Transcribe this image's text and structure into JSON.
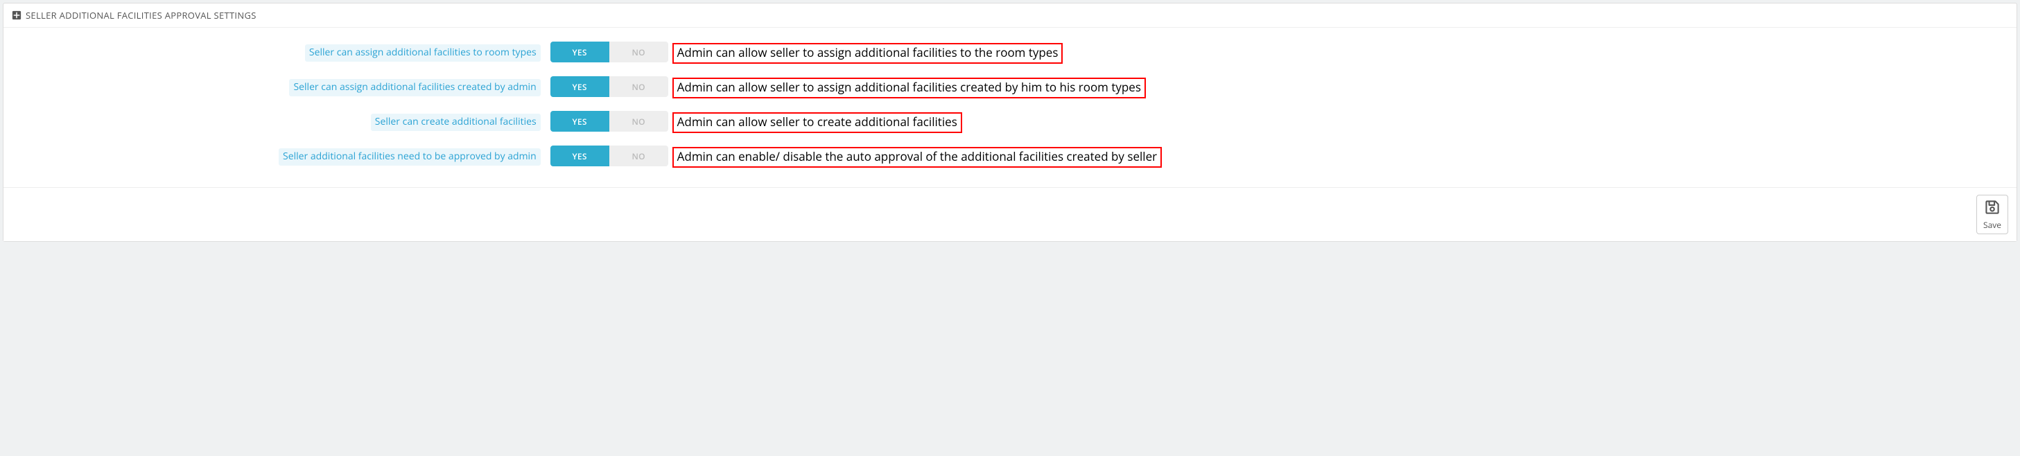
{
  "panel": {
    "title": "SELLER ADDITIONAL FACILITIES APPROVAL SETTINGS"
  },
  "toggle_labels": {
    "yes": "YES",
    "no": "NO"
  },
  "rows": [
    {
      "label": "Seller can assign additional facilities to room types",
      "value": "yes",
      "help": "Admin can allow seller to assign additional facilities to the room types"
    },
    {
      "label": "Seller can assign additional facilities created by admin",
      "value": "yes",
      "help": "Admin can allow seller to assign additional facilities created by him to his room types"
    },
    {
      "label": "Seller can create additional facilities",
      "value": "yes",
      "help": "Admin can allow seller to create additional facilities"
    },
    {
      "label": "Seller additional facilities need to be approved by admin",
      "value": "yes",
      "help": "Admin can enable/ disable the auto approval of the additional facilities created by seller"
    }
  ],
  "footer": {
    "save_label": "Save"
  }
}
